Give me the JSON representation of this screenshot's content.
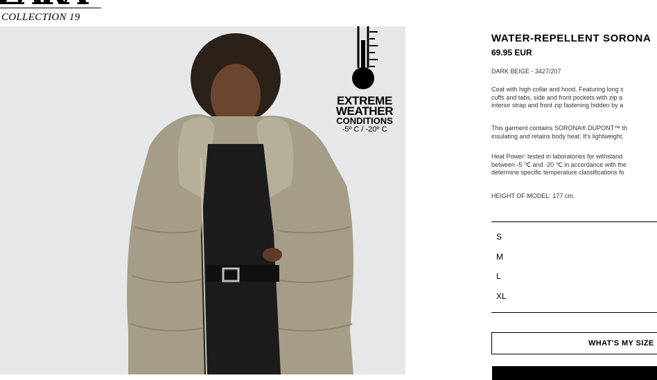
{
  "brand": {
    "logo_text": "ZARA",
    "collection": "COLLECTION 19"
  },
  "badge": {
    "line1": "EXTREME",
    "line2": "WEATHER",
    "line3": "CONDITIONS",
    "temperature": "-5º C / -20º C"
  },
  "product": {
    "title": "WATER-REPELLENT SORONA",
    "price": "69.95 EUR",
    "color_ref": "DARK BEIGE - 3427/207",
    "description_1": [
      "Coat with high collar and hood. Featuring long s",
      "cuffs and tabs, side and front pockets with zip a",
      "interior strap and front zip fastening hidden by a"
    ],
    "description_2": [
      "This garment contains SORONA® DUPONT™ th",
      "insulating and retains body heat. It's lightweight."
    ],
    "description_3": [
      "Heat Power: tested in laboratories for withstand",
      "between -5 ℃ and -20 ℃ in accordance with the",
      "determine specific temperature classifications fo"
    ],
    "model_height": "HEIGHT OF MODEL: 177 cm."
  },
  "sizes": [
    "S",
    "M",
    "L",
    "XL"
  ],
  "buttons": {
    "size_guide": "WHAT'S MY SIZE",
    "add_to_bag": ""
  },
  "colors": {
    "background": "#ffffff",
    "image_background": "#e6e7e9",
    "coat": "#a59d87",
    "button_dark": "#000000"
  }
}
